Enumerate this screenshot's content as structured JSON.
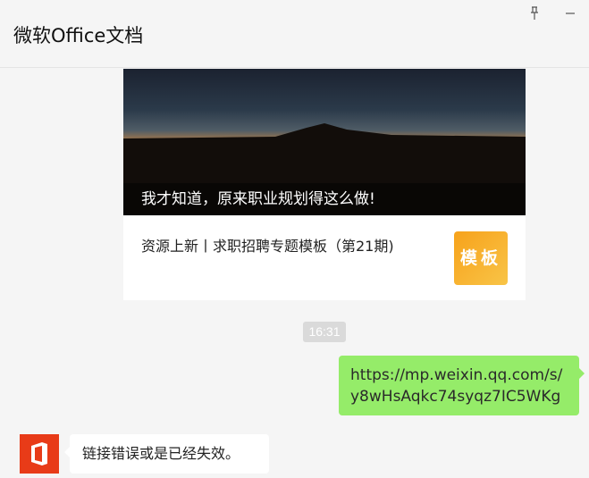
{
  "window": {
    "title": "微软Office文档",
    "pin_icon": "pin-icon",
    "minimize_icon": "minimize-icon"
  },
  "messages": {
    "article_card": {
      "image_caption": "我才知道，原来职业规划得这么做!",
      "headline": "资源上新丨求职招聘专题模板（第21期)",
      "thumbnail_text": "模板"
    },
    "timestamp": "16:31",
    "sent_link": {
      "line1": "https://mp.weixin.qq.com/s/",
      "line2": "y8wHsAqkc74syqz7IC5WKg"
    },
    "reply": {
      "avatar_icon": "office-logo-icon",
      "text": "链接错误或是已经失效。"
    }
  },
  "colors": {
    "sent_bubble": "#95ec69",
    "received_bubble": "#ffffff",
    "office_brand": "#e83b18",
    "thumbnail": "#f8b632"
  }
}
